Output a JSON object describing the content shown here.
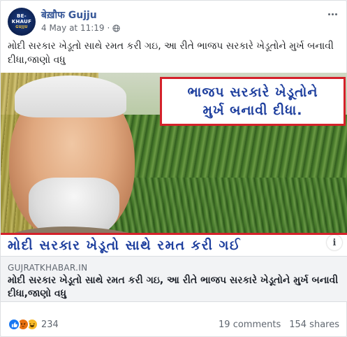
{
  "header": {
    "page_name": "बेख़ौफ Gujju",
    "timestamp": "4 May at 11:19",
    "separator": "·",
    "avatar_text": "BE-KHAUF",
    "avatar_sub": "GUJJU"
  },
  "post": {
    "text": "મોદી સરકાર ખેડૂતો સાથે રમત કરી ગઇ, આ રીતે ભાજપ સરકારે ખેડૂતોને મુર્ખ બનાવી દીધા,જાણો વધુ"
  },
  "image": {
    "headline_line1": "ભાજપ સરકારે ખેડૂતોને",
    "headline_line2": "મુર્ખ બનાવી દીધા.",
    "banner_text": "મોદી સરકાર ખેડૂતો સાથે રમત કરી ગઈ",
    "info_glyph": "i"
  },
  "link": {
    "domain": "GUJRATKHABAR.IN",
    "title": "મોદી સરકાર ખેડૂતો સાથે રમત કરી ગઇ, આ રીતે ભાજપ સરકારે ખેડૂતોને મુર્ખ બનાવી દીધા,જાણો વધુ"
  },
  "footer": {
    "reaction_count": "234",
    "comments": "19 comments",
    "shares": "154 shares"
  },
  "colors": {
    "link_blue": "#385898",
    "headline_blue": "#1e3f9e",
    "frame_red": "#d4212a",
    "like_blue": "#1877f2"
  },
  "icons": [
    "globe-icon",
    "more-options-icon",
    "info-icon",
    "like-reaction-icon",
    "angry-reaction-icon",
    "haha-reaction-icon"
  ]
}
